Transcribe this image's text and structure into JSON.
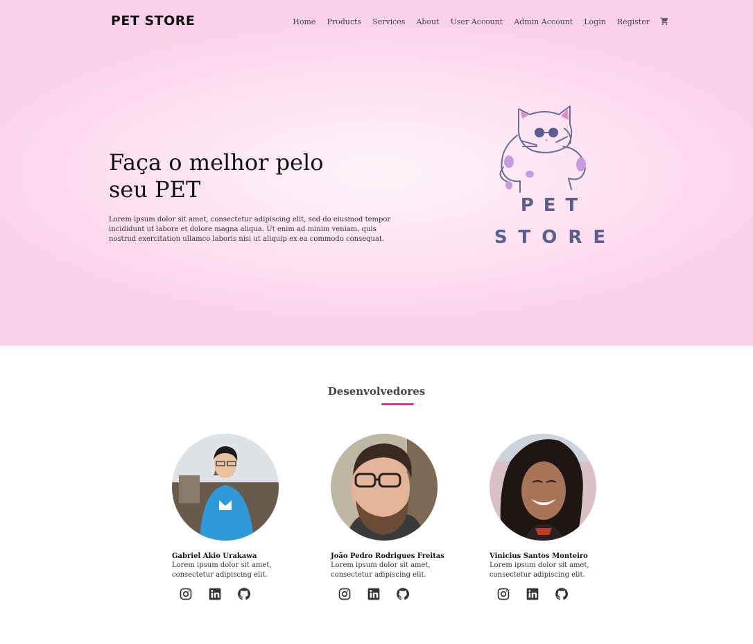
{
  "brand": {
    "logo_text": "PET STORE"
  },
  "nav": {
    "items": [
      {
        "label": "Home"
      },
      {
        "label": "Products"
      },
      {
        "label": "Services"
      },
      {
        "label": "About"
      },
      {
        "label": "User Account"
      },
      {
        "label": "Admin Account"
      },
      {
        "label": "Login"
      },
      {
        "label": "Register"
      }
    ],
    "cart_icon": "cart-icon"
  },
  "hero": {
    "headline_line1": "Faça o melhor pelo",
    "headline_line2": "seu PET",
    "intro": "Lorem ipsum dolor sit amet, consectetur adipiscing elit, sed do eiusmod tempor incididunt ut labore et dolore magna aliqua. Ut enim ad minim veniam, quis nostrud exercitation ullamco laboris nisi ut aliquip ex ea commodo consequat.",
    "illustration": {
      "line1": "PET",
      "line2": "STORE",
      "color": "#5b5d8e"
    }
  },
  "developers": {
    "title": "Desenvolvedores",
    "accent_color": "#e02aa5",
    "people": [
      {
        "name": "Gabriel Akio Urakawa",
        "bio": "Lorem ipsum dolor sit amet, consectetur adipiscing elit.",
        "socials": [
          "instagram-icon",
          "linkedin-icon",
          "github-icon"
        ]
      },
      {
        "name": "João Pedro Rodrigues Freitas",
        "bio": "Lorem ipsum dolor sit amet, consectetur adipiscing elit.",
        "socials": [
          "instagram-icon",
          "linkedin-icon",
          "github-icon"
        ]
      },
      {
        "name": "Vinicius Santos Monteiro",
        "bio": "Lorem ipsum dolor sit amet, consectetur adipiscing elit.",
        "socials": [
          "instagram-icon",
          "linkedin-icon",
          "github-icon"
        ]
      }
    ]
  }
}
